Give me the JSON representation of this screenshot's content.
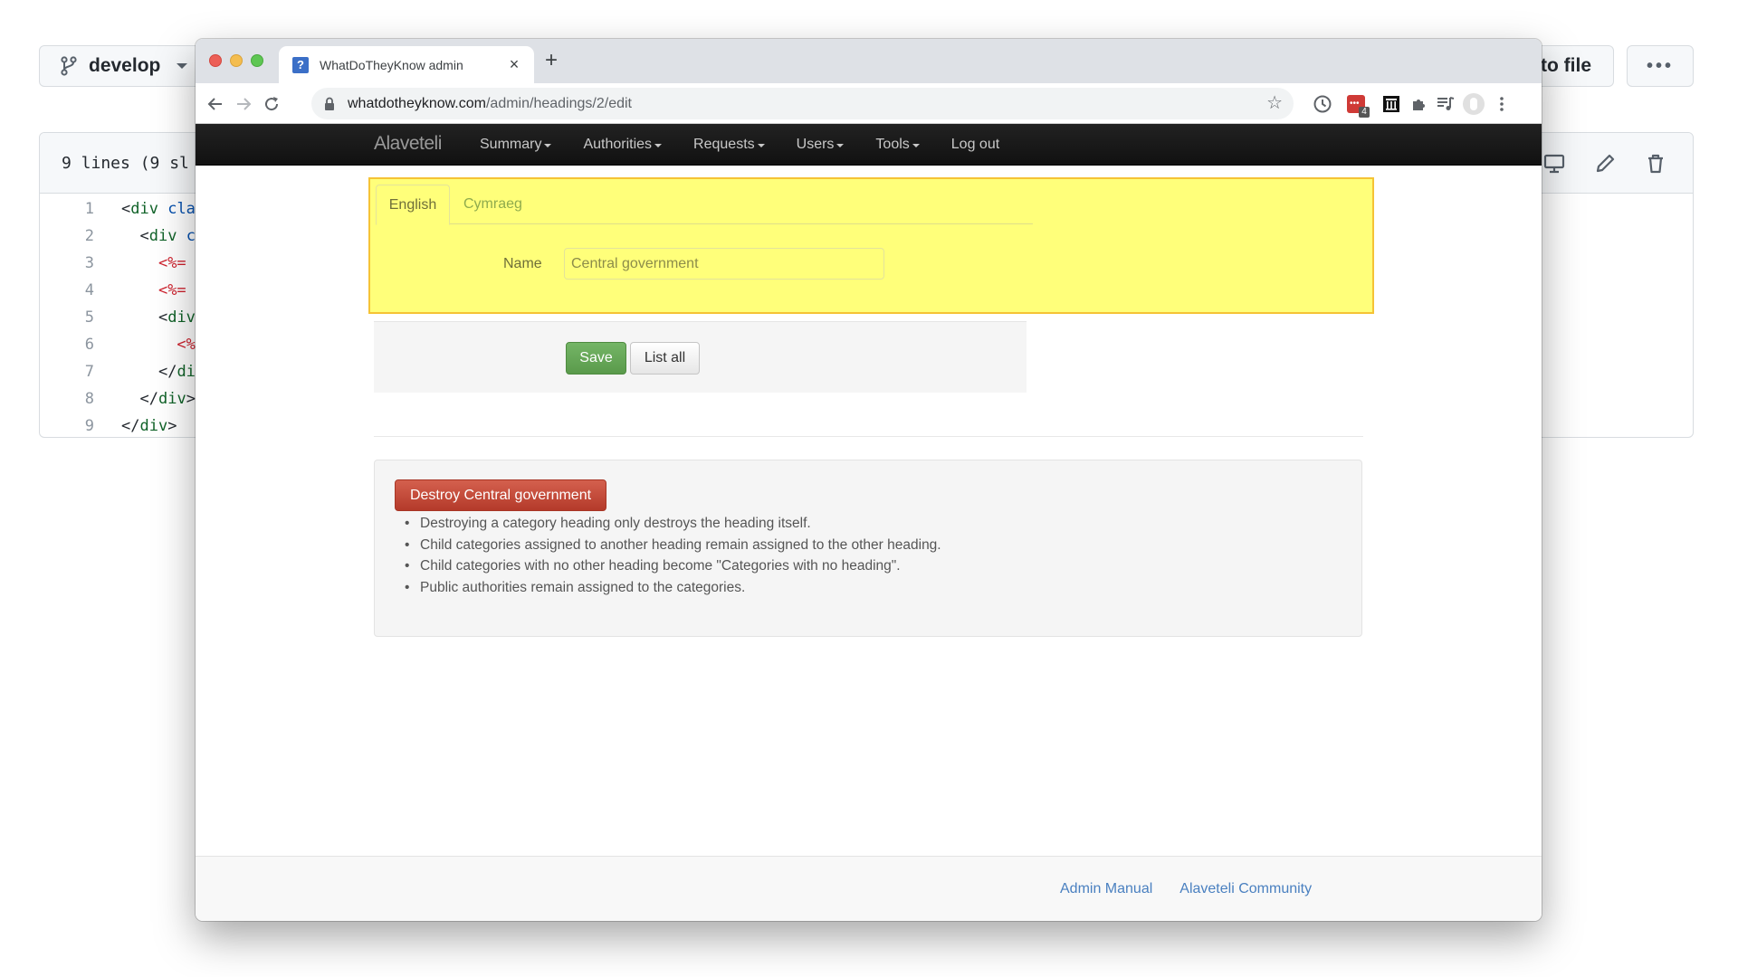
{
  "github": {
    "branch_label": "develop",
    "go_to_file_label": "to file",
    "more_label": "•••",
    "file_info": "9 lines (9 sl",
    "code_lines": [
      {
        "num": "1",
        "tokens": [
          {
            "t": "<",
            "c": "punct"
          },
          {
            "t": "div",
            "c": "tag"
          },
          {
            "t": " cla",
            "c": "attr"
          }
        ],
        "indent": ""
      },
      {
        "num": "2",
        "tokens": [
          {
            "t": "<",
            "c": "punct"
          },
          {
            "t": "div",
            "c": "tag"
          },
          {
            "t": " c",
            "c": "attr"
          }
        ],
        "indent": "  "
      },
      {
        "num": "3",
        "tokens": [
          {
            "t": "<%=",
            "c": "erb"
          }
        ],
        "indent": "    "
      },
      {
        "num": "4",
        "tokens": [
          {
            "t": "<%=",
            "c": "erb"
          }
        ],
        "indent": "    "
      },
      {
        "num": "5",
        "tokens": [
          {
            "t": "<",
            "c": "punct"
          },
          {
            "t": "div",
            "c": "tag"
          }
        ],
        "indent": "    "
      },
      {
        "num": "6",
        "tokens": [
          {
            "t": "<%",
            "c": "erb"
          }
        ],
        "indent": "      "
      },
      {
        "num": "7",
        "tokens": [
          {
            "t": "</",
            "c": "punct"
          },
          {
            "t": "di",
            "c": "tag"
          }
        ],
        "indent": "    "
      },
      {
        "num": "8",
        "tokens": [
          {
            "t": "</",
            "c": "punct"
          },
          {
            "t": "div",
            "c": "tag"
          },
          {
            "t": ">",
            "c": "punct"
          }
        ],
        "indent": "  "
      },
      {
        "num": "9",
        "tokens": [
          {
            "t": "</",
            "c": "punct"
          },
          {
            "t": "div",
            "c": "tag"
          },
          {
            "t": ">",
            "c": "punct"
          }
        ],
        "indent": ""
      }
    ]
  },
  "browser": {
    "tab_title": "WhatDoTheyKnow admin",
    "favicon_glyph": "?",
    "tab_close": "×",
    "new_tab": "+",
    "url_host": "whatdotheyknow.com",
    "url_path": "/admin/headings/2/edit",
    "extension_badge": "4"
  },
  "navbar": {
    "brand": "Alaveteli",
    "items": [
      {
        "label": "Summary",
        "dropdown": true
      },
      {
        "label": "Authorities",
        "dropdown": true
      },
      {
        "label": "Requests",
        "dropdown": true
      },
      {
        "label": "Users",
        "dropdown": true
      },
      {
        "label": "Tools",
        "dropdown": true
      },
      {
        "label": "Log out",
        "dropdown": false
      }
    ]
  },
  "form": {
    "highlight_color": "#ffff7a",
    "language_tabs": [
      {
        "label": "English",
        "active": true
      },
      {
        "label": "Cymraeg",
        "active": false
      }
    ],
    "name_label": "Name",
    "name_value": "Central government",
    "save_label": "Save",
    "list_all_label": "List all"
  },
  "destroy": {
    "button_label": "Destroy Central government",
    "notes": [
      "Destroying a category heading only destroys the heading itself.",
      "Child categories assigned to another heading remain assigned to the other heading.",
      "Child categories with no other heading become \"Categories with no heading\".",
      "Public authorities remain assigned to the categories."
    ]
  },
  "footer": {
    "links": [
      "Admin Manual",
      "Alaveteli Community"
    ]
  }
}
